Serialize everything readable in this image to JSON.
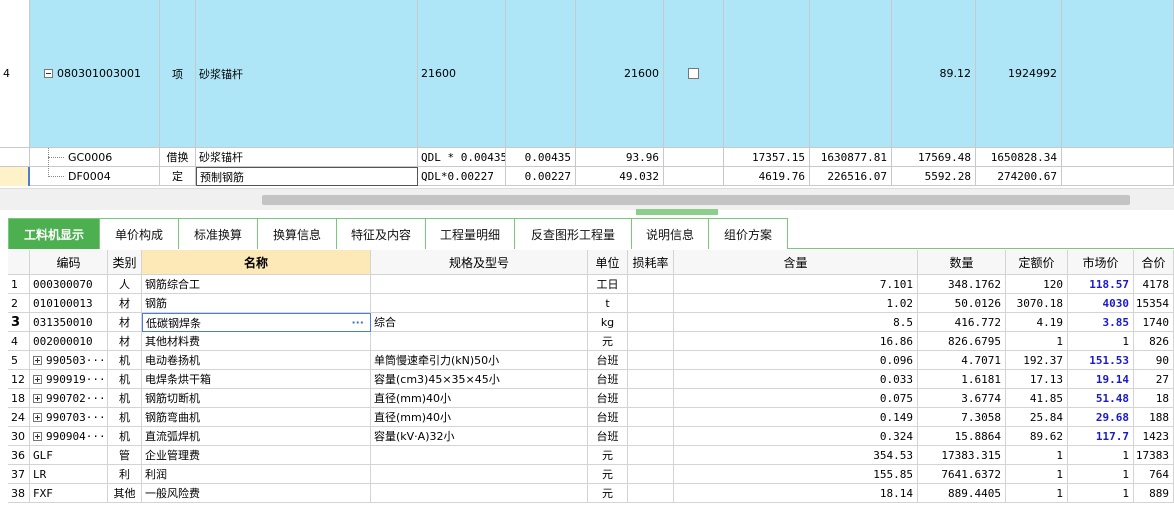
{
  "upper": {
    "rows": [
      {
        "row": "4",
        "code": "080301003001",
        "type": "项",
        "name": "砂浆锚杆",
        "expr": "21600",
        "qty1": "",
        "qty2": "21600",
        "checkbox": true,
        "p1": "",
        "t1": "",
        "p2": "89.12",
        "t2": "1924992"
      },
      {
        "row": "",
        "code": "GC0006",
        "type": "借换",
        "name": "砂浆锚杆",
        "expr": "QDL * 0.00435",
        "qty1": "0.00435",
        "qty2": "93.96",
        "checkbox": false,
        "p1": "17357.15",
        "t1": "1630877.81",
        "p2": "17569.48",
        "t2": "1650828.34"
      },
      {
        "row": "",
        "code": "DF0004",
        "type": "定",
        "name": "预制钢筋",
        "expr": "QDL*0.00227",
        "qty1": "0.00227",
        "qty2": "49.032",
        "checkbox": false,
        "p1": "4619.76",
        "t1": "226516.07",
        "p2": "5592.28",
        "t2": "274200.67"
      }
    ]
  },
  "tabs": [
    "工料机显示",
    "单价构成",
    "标准换算",
    "换算信息",
    "特征及内容",
    "工程量明细",
    "反查图形工程量",
    "说明信息",
    "组价方案"
  ],
  "lower": {
    "headers": [
      "编码",
      "类别",
      "名称",
      "规格及型号",
      "单位",
      "损耗率",
      "含量",
      "数量",
      "定额价",
      "市场价",
      "合价"
    ],
    "rows": [
      {
        "n": "1",
        "code": "000300070",
        "exp": false,
        "cat": "人",
        "name": "钢筋综合工",
        "spec": "",
        "unit": "工日",
        "loss": "",
        "content": "7.101",
        "qty": "348.1762",
        "quota": "120",
        "market": "118.57",
        "total": "4178",
        "mblue": true
      },
      {
        "n": "2",
        "code": "010100013",
        "exp": false,
        "cat": "材",
        "name": "钢筋",
        "spec": "",
        "unit": "t",
        "loss": "",
        "content": "1.02",
        "qty": "50.0126",
        "quota": "3070.18",
        "market": "4030",
        "total": "15354",
        "mblue": true
      },
      {
        "n": "3",
        "code": "031350010",
        "exp": false,
        "cat": "材",
        "name": "低碳钢焊条",
        "spec": "综合",
        "unit": "kg",
        "loss": "",
        "content": "8.5",
        "qty": "416.772",
        "quota": "4.19",
        "market": "3.85",
        "total": "1740",
        "mblue": true
      },
      {
        "n": "4",
        "code": "002000010",
        "exp": false,
        "cat": "材",
        "name": "其他材料费",
        "spec": "",
        "unit": "元",
        "loss": "",
        "content": "16.86",
        "qty": "826.6795",
        "quota": "1",
        "market": "1",
        "total": "826",
        "mblue": false
      },
      {
        "n": "5",
        "code": "990503···",
        "exp": true,
        "cat": "机",
        "name": "电动卷扬机",
        "spec": "单筒慢速牵引力(kN)50小",
        "unit": "台班",
        "loss": "",
        "content": "0.096",
        "qty": "4.7071",
        "quota": "192.37",
        "market": "151.53",
        "total": "90",
        "mblue": true
      },
      {
        "n": "12",
        "code": "990919···",
        "exp": true,
        "cat": "机",
        "name": "电焊条烘干箱",
        "spec": "容量(cm3)45×35×45小",
        "unit": "台班",
        "loss": "",
        "content": "0.033",
        "qty": "1.6181",
        "quota": "17.13",
        "market": "19.14",
        "total": "27",
        "mblue": true
      },
      {
        "n": "18",
        "code": "990702···",
        "exp": true,
        "cat": "机",
        "name": "钢筋切断机",
        "spec": "直径(mm)40小",
        "unit": "台班",
        "loss": "",
        "content": "0.075",
        "qty": "3.6774",
        "quota": "41.85",
        "market": "51.48",
        "total": "18",
        "mblue": true
      },
      {
        "n": "24",
        "code": "990703···",
        "exp": true,
        "cat": "机",
        "name": "钢筋弯曲机",
        "spec": "直径(mm)40小",
        "unit": "台班",
        "loss": "",
        "content": "0.149",
        "qty": "7.3058",
        "quota": "25.84",
        "market": "29.68",
        "total": "188",
        "mblue": true
      },
      {
        "n": "30",
        "code": "990904···",
        "exp": true,
        "cat": "机",
        "name": "直流弧焊机",
        "spec": "容量(kV·A)32小",
        "unit": "台班",
        "loss": "",
        "content": "0.324",
        "qty": "15.8864",
        "quota": "89.62",
        "market": "117.7",
        "total": "1423",
        "mblue": true
      },
      {
        "n": "36",
        "code": "GLF",
        "exp": false,
        "cat": "管",
        "name": "企业管理费",
        "spec": "",
        "unit": "元",
        "loss": "",
        "content": "354.53",
        "qty": "17383.315",
        "quota": "1",
        "market": "1",
        "total": "17383",
        "mblue": false
      },
      {
        "n": "37",
        "code": "LR",
        "exp": false,
        "cat": "利",
        "name": "利润",
        "spec": "",
        "unit": "元",
        "loss": "",
        "content": "155.85",
        "qty": "7641.6372",
        "quota": "1",
        "market": "1",
        "total": "764",
        "mblue": false
      },
      {
        "n": "38",
        "code": "FXF",
        "exp": false,
        "cat": "其他",
        "name": "一般风险费",
        "spec": "",
        "unit": "元",
        "loss": "",
        "content": "18.14",
        "qty": "889.4405",
        "quota": "1",
        "market": "1",
        "total": "889",
        "mblue": false
      }
    ]
  },
  "colors": {
    "highlight": "#aee5f7",
    "tab_active": "#4caf50",
    "market_blue": "#1a1acc",
    "header_selected": "#fde9b8"
  }
}
